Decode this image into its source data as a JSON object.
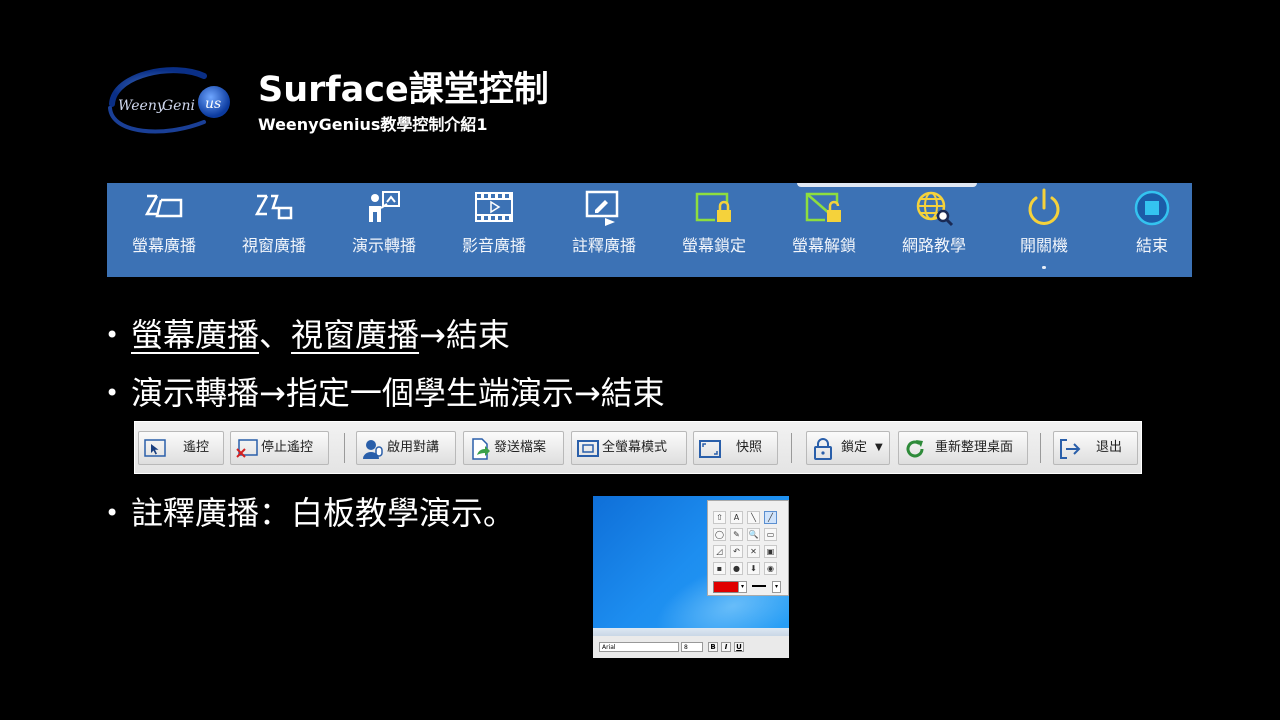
{
  "header": {
    "logo_text": "WeenyGenius",
    "title": "Surface課堂控制",
    "subtitle": "WeenyGenius教學控制介紹1"
  },
  "toolbar_main": {
    "items": [
      {
        "label": "螢幕廣播",
        "icon": "screen-broadcast-icon"
      },
      {
        "label": "視窗廣播",
        "icon": "window-broadcast-icon"
      },
      {
        "label": "演示轉播",
        "icon": "demo-relay-icon"
      },
      {
        "label": "影音廣播",
        "icon": "video-broadcast-icon"
      },
      {
        "label": "註釋廣播",
        "icon": "annotation-broadcast-icon"
      },
      {
        "label": "螢幕鎖定",
        "icon": "screen-lock-icon"
      },
      {
        "label": "螢幕解鎖",
        "icon": "screen-unlock-icon"
      },
      {
        "label": "網路教學",
        "icon": "web-teaching-icon"
      },
      {
        "label": "開關機",
        "icon": "power-icon"
      },
      {
        "label": "結束",
        "icon": "stop-icon"
      }
    ]
  },
  "bullets": {
    "b1": {
      "part1": "螢幕廣播",
      "sep": "、",
      "part2": "視窗廣播",
      "rest": "→結束"
    },
    "b2": "演示轉播→指定一個學生端演示→結束",
    "b3": "註釋廣播：白板教學演示。"
  },
  "toolbar_demo": {
    "items": [
      {
        "label": "遙控",
        "icon": "remote-control-icon"
      },
      {
        "label": "停止遙控",
        "icon": "stop-remote-icon"
      },
      {
        "label": "啟用對講",
        "icon": "intercom-icon"
      },
      {
        "label": "發送檔案",
        "icon": "send-file-icon"
      },
      {
        "label": "全螢幕模式",
        "icon": "fullscreen-icon"
      },
      {
        "label": "快照",
        "icon": "snapshot-icon"
      },
      {
        "label": "鎖定",
        "icon": "lock-icon"
      },
      {
        "label": "重新整理桌面",
        "icon": "refresh-icon"
      },
      {
        "label": "退出",
        "icon": "exit-icon"
      }
    ]
  },
  "whiteboard": {
    "palette_tools": [
      "⇧",
      "A",
      "╲",
      "╱",
      "◯",
      "✎",
      "🔍",
      "▭",
      "◿",
      "↶",
      "✕",
      "▣",
      "▪",
      "●",
      "⬇",
      "◉"
    ],
    "current_color": "#e00000",
    "font_name": "Arial",
    "font_size": "8",
    "style_buttons": [
      "B",
      "I",
      "U"
    ]
  },
  "colors": {
    "background": "#000000",
    "toolbar_blue": "#3c72b5",
    "icon_accent_green": "#8ede3f",
    "icon_accent_yellow": "#f5d23b",
    "icon_accent_cyan": "#34c3f0"
  }
}
